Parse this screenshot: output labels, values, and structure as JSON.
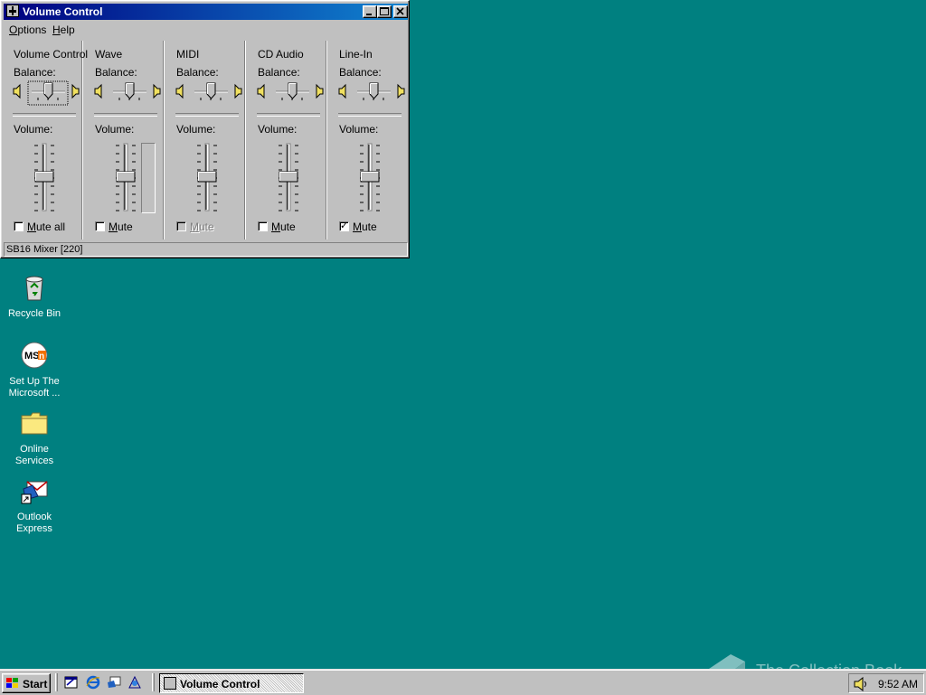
{
  "window": {
    "title": "Volume Control",
    "menu": [
      {
        "label": "Options",
        "hotkey": "O",
        "rest": "ptions"
      },
      {
        "label": "Help",
        "hotkey": "H",
        "rest": "elp"
      }
    ],
    "columns": [
      {
        "title": "Volume Control",
        "balance_label": "Balance:",
        "volume_label": "Volume:",
        "mute_label": "Mute all",
        "mute_hotkey": "M",
        "mute_rest": "ute all",
        "muted": false,
        "mute_disabled": false,
        "has_meter": false,
        "balance_focused": true
      },
      {
        "title": "Wave",
        "balance_label": "Balance:",
        "volume_label": "Volume:",
        "mute_label": "Mute",
        "mute_hotkey": "M",
        "mute_rest": "ute",
        "muted": false,
        "mute_disabled": false,
        "has_meter": true
      },
      {
        "title": "MIDI",
        "balance_label": "Balance:",
        "volume_label": "Volume:",
        "mute_label": "Mute",
        "mute_hotkey": "M",
        "mute_rest": "ute",
        "muted": false,
        "mute_disabled": true,
        "has_meter": false
      },
      {
        "title": "CD Audio",
        "balance_label": "Balance:",
        "volume_label": "Volume:",
        "mute_label": "Mute",
        "mute_hotkey": "M",
        "mute_rest": "ute",
        "muted": false,
        "mute_disabled": false,
        "has_meter": false
      },
      {
        "title": "Line-In",
        "balance_label": "Balance:",
        "volume_label": "Volume:",
        "mute_label": "Mute",
        "mute_hotkey": "M",
        "mute_rest": "ute",
        "muted": true,
        "mute_disabled": false,
        "has_meter": false
      }
    ],
    "status": "SB16 Mixer [220]"
  },
  "desktop_icons": [
    {
      "label_lines": [
        "Recycle Bin"
      ],
      "icon": "recycle-bin-icon"
    },
    {
      "label_lines": [
        "Set Up The",
        "Microsoft ..."
      ],
      "icon": "msn-icon"
    },
    {
      "label_lines": [
        "Online",
        "Services"
      ],
      "icon": "folder-icon"
    },
    {
      "label_lines": [
        "Outlook",
        "Express"
      ],
      "icon": "outlook-express-icon"
    }
  ],
  "taskbar": {
    "start_label": "Start",
    "task_label": "Volume Control",
    "clock": "9:52 AM"
  },
  "watermark": "The Collection Book",
  "colors": {
    "desktop": "#008080",
    "title_start": "#000080",
    "title_end": "#1084d0",
    "face": "#c0c0c0"
  }
}
